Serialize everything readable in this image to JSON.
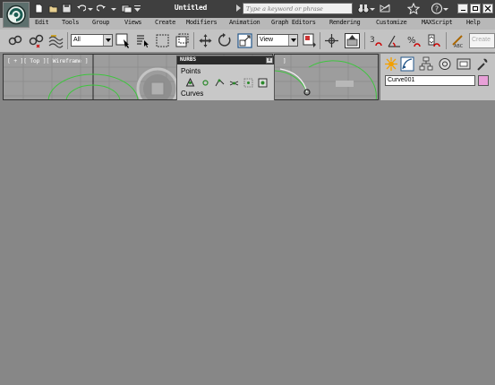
{
  "window": {
    "title": "Untitled",
    "search_placeholder": "Type a keyword or phrase"
  },
  "menu": {
    "items": [
      "Edit",
      "Tools",
      "Group",
      "Views",
      "Create",
      "Modifiers",
      "Animation",
      "Graph Editors",
      "Rendering",
      "Customize",
      "MAXScript",
      "Help"
    ]
  },
  "toolbar": {
    "selection_filter": "All",
    "reference_coord": "View",
    "named_selection_placeholder": "Create"
  },
  "viewport": {
    "label": "[ + ][ Top ][ Wireframe ]"
  },
  "nurbs_panel": {
    "title": "NURBS",
    "close_label": "x",
    "points_label": "Points",
    "curves_label": "Curves"
  },
  "command_panel": {
    "object_name": "Curve001",
    "object_color": "#e8a0d8"
  },
  "colors": {
    "title_bar": "#3f3f3f",
    "menu_bar": "#b8b8b8",
    "toolbar": "#c3c3c3",
    "viewport_bg": "#9d9d9d",
    "workspace_bg": "#878787",
    "nurbs_curve": "#3ec53e"
  }
}
